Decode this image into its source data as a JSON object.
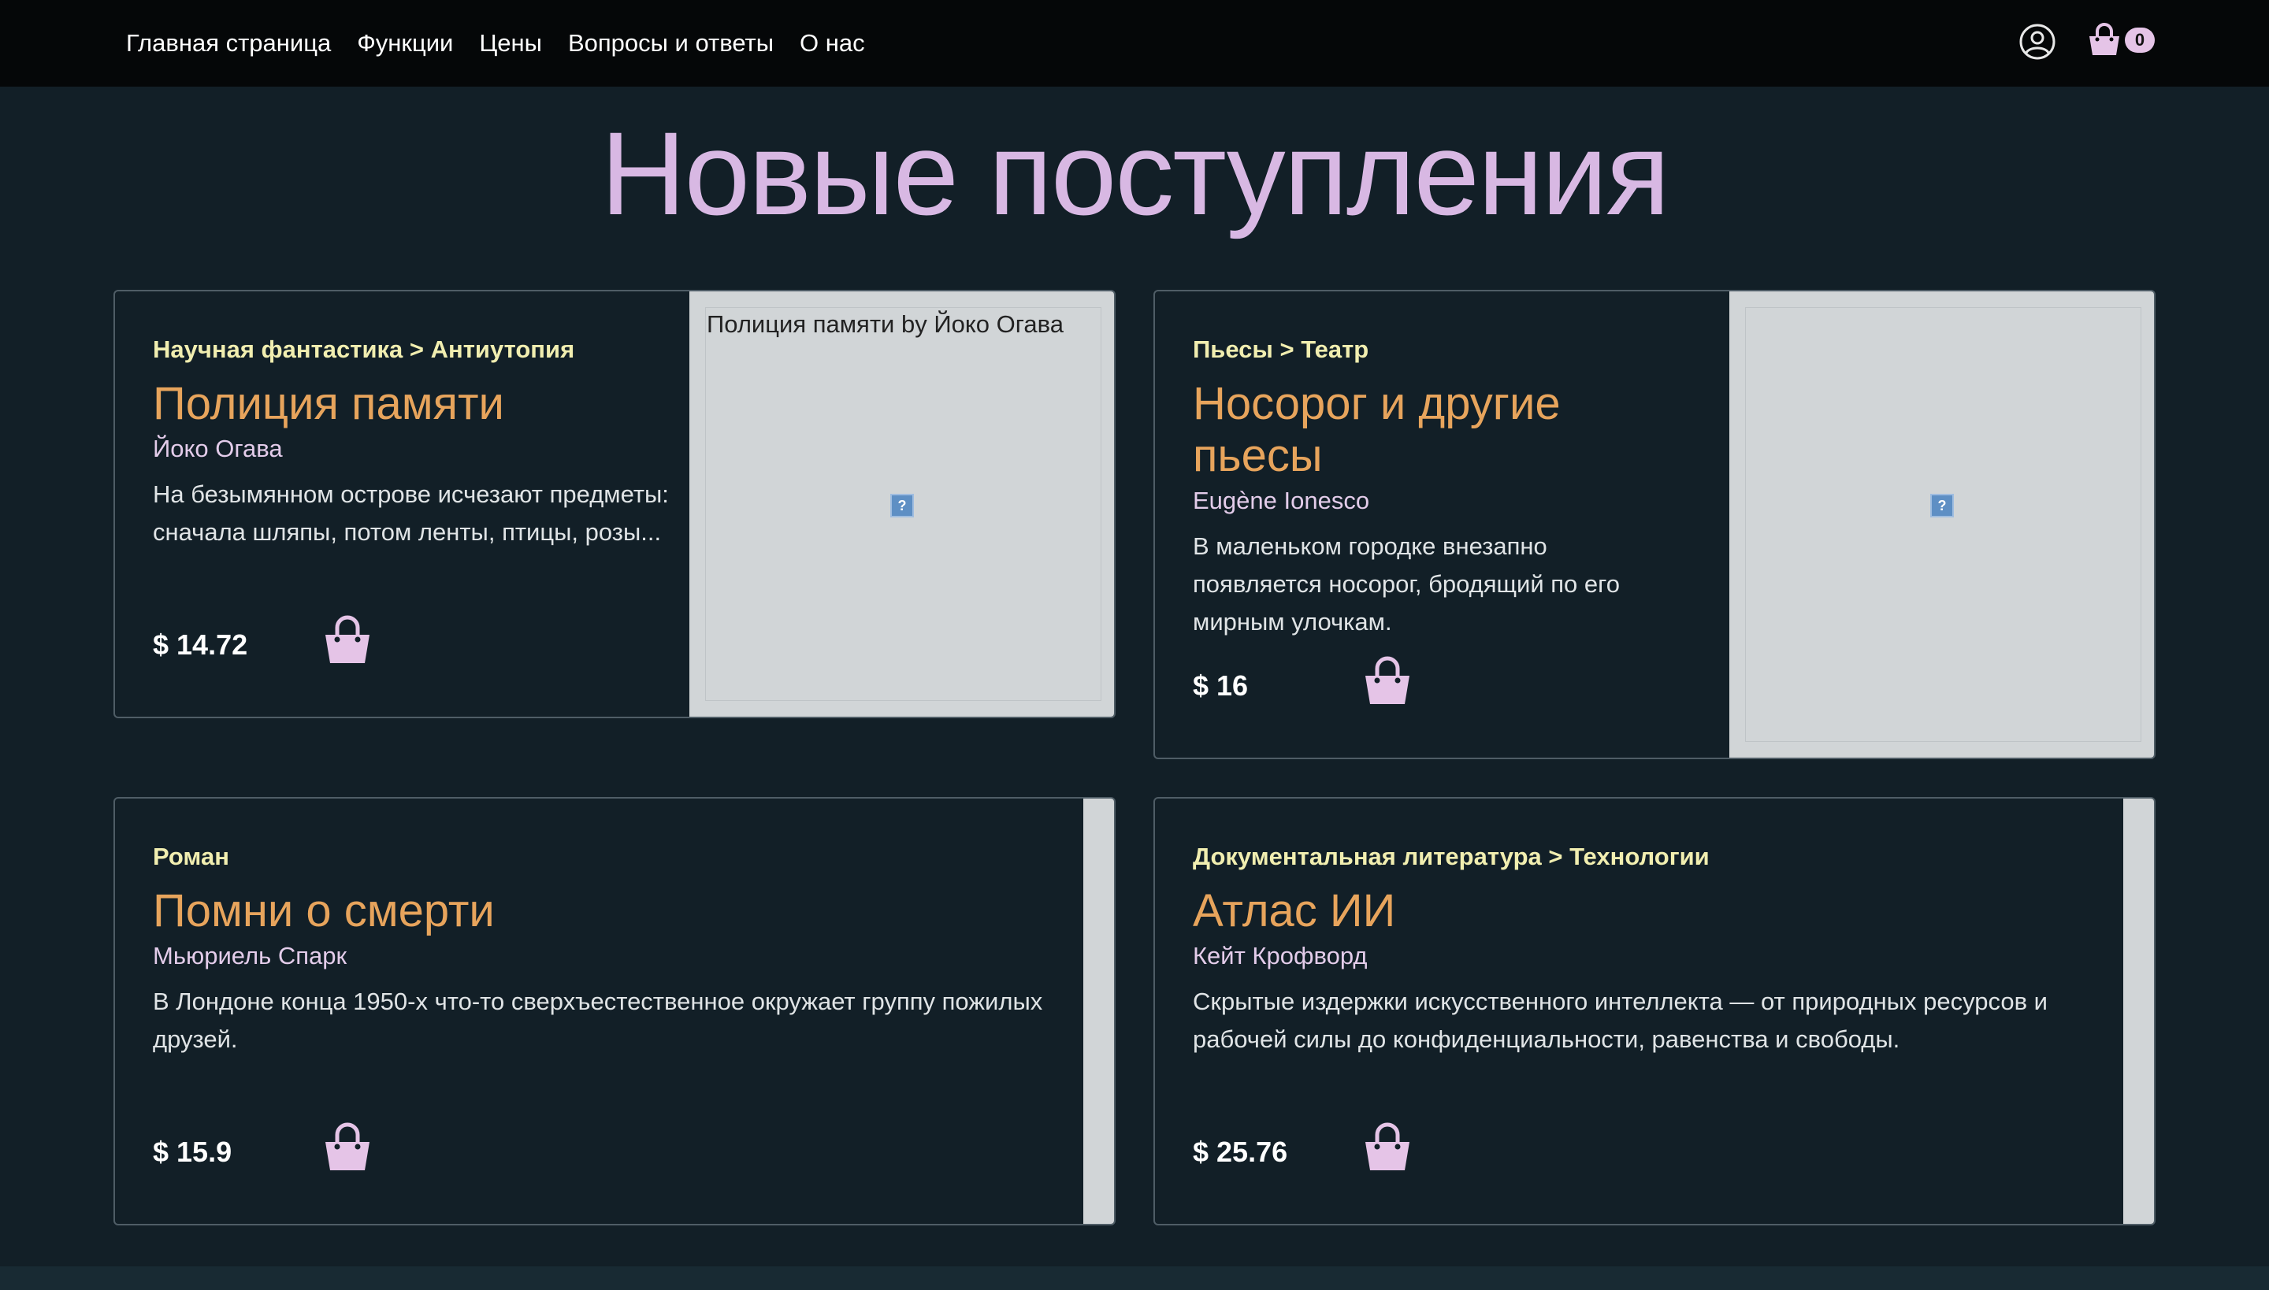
{
  "nav": {
    "items": [
      "Главная страница",
      "Функции",
      "Цены",
      "Вопросы и ответы",
      "О нас"
    ],
    "cart_count": "0"
  },
  "page_title": "Новые поступления",
  "colors": {
    "background": "#121f27",
    "topbar": "#050708",
    "title": "#d8b8e3",
    "book_title": "#e7a45c",
    "category": "#f1eeb0",
    "accent": "#e5c4e7"
  },
  "icons": {
    "user": "user-circle-icon",
    "cart": "shopping-basket-icon",
    "buy": "shopping-basket-icon",
    "broken_image": "broken-image-icon"
  },
  "books": [
    {
      "category": "Научная фантастика > Антиутопия",
      "title": "Полиция памяти",
      "author": "Йоко Огава",
      "description": "На безымянном острове исчезают предметы: сначала шляпы, потом ленты, птицы, розы...",
      "price": "$ 14.72",
      "image_alt": "Полиция памяти by Йоко Огава"
    },
    {
      "category": "Пьесы > Театр",
      "title": "Носорог и другие пьесы",
      "author": "Eugène Ionesco",
      "description": "В маленьком городке внезапно появляется носорог, бродящий по его мирным улочкам.",
      "price": "$ 16",
      "image_alt": ""
    },
    {
      "category": "Роман",
      "title": "Помни о смерти",
      "author": "Мьюриель Спарк",
      "description": "В Лондоне конца 1950-х что-то сверхъестественное окружает группу пожилых друзей.",
      "price": "$ 15.9",
      "image_alt": ""
    },
    {
      "category": "Документальная литература > Технологии",
      "title": "Атлас ИИ",
      "author": "Кейт Крофворд",
      "description": "Скрытые издержки искусственного интеллекта — от природных ресурсов и рабочей силы до конфиденциальности, равенства и свободы.",
      "price": "$ 25.76",
      "image_alt": ""
    }
  ]
}
